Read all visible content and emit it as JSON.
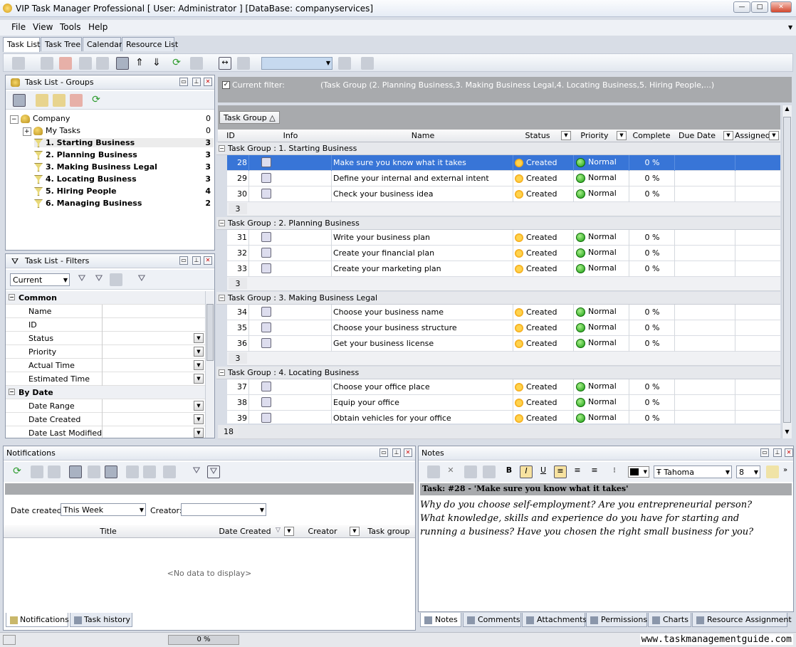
{
  "window": {
    "title": "VIP Task Manager Professional [ User: Administrator ] [DataBase: companyservices]"
  },
  "menu": [
    "File",
    "View",
    "Tools",
    "Help"
  ],
  "main_tabs": [
    "Task List",
    "Task Tree",
    "Calendar",
    "Resource List"
  ],
  "groups_panel": {
    "title": "Task List - Groups",
    "items": [
      {
        "label": "Company",
        "count": "0",
        "bold": false,
        "indent": 0
      },
      {
        "label": "My Tasks",
        "count": "0",
        "bold": false,
        "indent": 1
      },
      {
        "label": "1. Starting Business",
        "count": "3",
        "bold": true,
        "indent": 1
      },
      {
        "label": "2. Planning Business",
        "count": "3",
        "bold": true,
        "indent": 1
      },
      {
        "label": "3. Making Business Legal",
        "count": "3",
        "bold": true,
        "indent": 1
      },
      {
        "label": "4. Locating Business",
        "count": "3",
        "bold": true,
        "indent": 1
      },
      {
        "label": "5. Hiring People",
        "count": "4",
        "bold": true,
        "indent": 1
      },
      {
        "label": "6. Managing Business",
        "count": "2",
        "bold": true,
        "indent": 1
      }
    ]
  },
  "filters_panel": {
    "title": "Task List - Filters",
    "current": "Current",
    "rows": [
      {
        "label": "Common",
        "section": true,
        "dropdown": false
      },
      {
        "label": "Name",
        "section": false,
        "dropdown": false
      },
      {
        "label": "ID",
        "section": false,
        "dropdown": false
      },
      {
        "label": "Status",
        "section": false,
        "dropdown": true
      },
      {
        "label": "Priority",
        "section": false,
        "dropdown": true
      },
      {
        "label": "Actual Time",
        "section": false,
        "dropdown": true
      },
      {
        "label": "Estimated Time",
        "section": false,
        "dropdown": true
      },
      {
        "label": "By Date",
        "section": true,
        "dropdown": false
      },
      {
        "label": "Date Range",
        "section": false,
        "dropdown": true
      },
      {
        "label": "Date Created",
        "section": false,
        "dropdown": true
      },
      {
        "label": "Date Last Modified",
        "section": false,
        "dropdown": true
      }
    ]
  },
  "filter_bar": {
    "label": "Current filter:",
    "value": "(Task Group  (2. Planning Business,3. Making Business Legal,4. Locating Business,5. Hiring People,...)"
  },
  "group_by": "Task Group",
  "sort_glyph": "△",
  "columns": [
    "ID",
    "Info",
    "Name",
    "Status",
    "Priority",
    "Complete",
    "Due Date",
    "Assigned"
  ],
  "groups": [
    {
      "title": "Task Group : 1. Starting Business",
      "count": "3",
      "rows": [
        {
          "id": "28",
          "name": "Make sure you know what it takes",
          "status": "Created",
          "priority": "Normal",
          "complete": "0 %",
          "selected": true
        },
        {
          "id": "29",
          "name": "Define your internal and external intent",
          "status": "Created",
          "priority": "Normal",
          "complete": "0 %",
          "selected": false
        },
        {
          "id": "30",
          "name": "Check your business idea",
          "status": "Created",
          "priority": "Normal",
          "complete": "0 %",
          "selected": false
        }
      ]
    },
    {
      "title": "Task Group : 2. Planning Business",
      "count": "3",
      "rows": [
        {
          "id": "31",
          "name": "Write your business plan",
          "status": "Created",
          "priority": "Normal",
          "complete": "0 %",
          "selected": false
        },
        {
          "id": "32",
          "name": "Create your financial plan",
          "status": "Created",
          "priority": "Normal",
          "complete": "0 %",
          "selected": false
        },
        {
          "id": "33",
          "name": "Create your marketing plan",
          "status": "Created",
          "priority": "Normal",
          "complete": "0 %",
          "selected": false
        }
      ]
    },
    {
      "title": "Task Group : 3. Making Business Legal",
      "count": "3",
      "rows": [
        {
          "id": "34",
          "name": "Choose your business name",
          "status": "Created",
          "priority": "Normal",
          "complete": "0 %",
          "selected": false
        },
        {
          "id": "35",
          "name": "Choose your business structure",
          "status": "Created",
          "priority": "Normal",
          "complete": "0 %",
          "selected": false
        },
        {
          "id": "36",
          "name": "Get your business license",
          "status": "Created",
          "priority": "Normal",
          "complete": "0 %",
          "selected": false
        }
      ]
    },
    {
      "title": "Task Group : 4. Locating Business",
      "count": "",
      "rows": [
        {
          "id": "37",
          "name": "Choose your office place",
          "status": "Created",
          "priority": "Normal",
          "complete": "0 %",
          "selected": false
        },
        {
          "id": "38",
          "name": "Equip your office",
          "status": "Created",
          "priority": "Normal",
          "complete": "0 %",
          "selected": false
        },
        {
          "id": "39",
          "name": "Obtain vehicles for your office",
          "status": "Created",
          "priority": "Normal",
          "complete": "0 %",
          "selected": false
        }
      ]
    }
  ],
  "total_count": "18",
  "notifications": {
    "title": "Notifications",
    "date_label": "Date created:",
    "date_value": "This Week",
    "creator_label": "Creator:",
    "columns": [
      "Title",
      "Date Created",
      "Creator",
      "Task group"
    ],
    "empty": "<No data to display>",
    "tabs": [
      "Notifications",
      "Task history"
    ]
  },
  "notes": {
    "title": "Notes",
    "font": "Tahoma",
    "size": "8",
    "task_header": "Task: #28 - 'Make sure you know what it takes'",
    "text": "Why do you choose self-employment? Are you entrepreneurial person? What knowledge, skills and experience do you have for starting and running a business? Have you chosen the right small business for you?",
    "tabs": [
      "Notes",
      "Comments",
      "Attachments",
      "Permissions",
      "Charts",
      "Resource Assignment"
    ]
  },
  "status_bar": {
    "progress": "0 %"
  },
  "watermark": "www.taskmanagementguide.com"
}
